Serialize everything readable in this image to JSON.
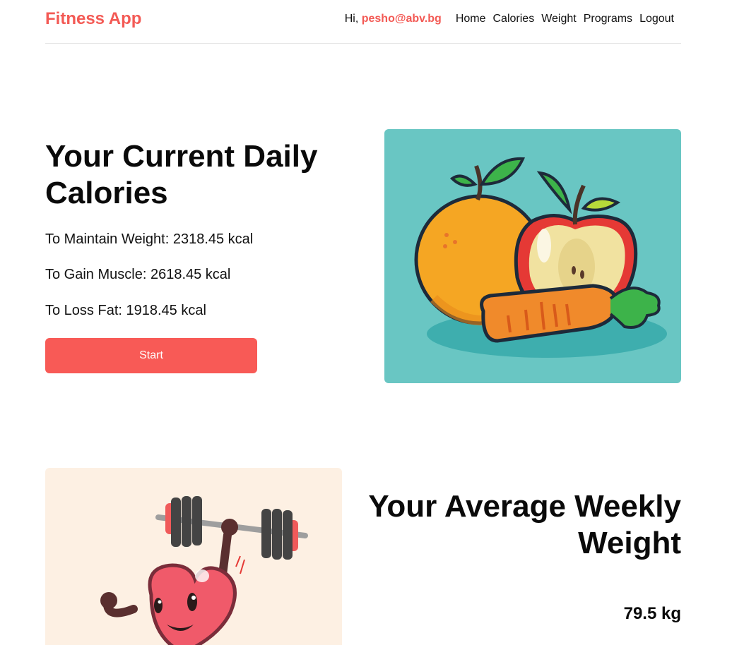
{
  "header": {
    "brand": "Fitness App",
    "greeting_prefix": "Hi, ",
    "user_email": "pesho@abv.bg",
    "nav": [
      {
        "label": "Home"
      },
      {
        "label": "Calories"
      },
      {
        "label": "Weight"
      },
      {
        "label": "Programs"
      },
      {
        "label": "Logout"
      }
    ]
  },
  "calories": {
    "title": "Your Current Daily Calories",
    "maintain": "To Maintain Weight: 2318.45 kcal",
    "gain": "To Gain Muscle: 2618.45 kcal",
    "loss": "To Loss Fat: 1918.45 kcal",
    "start_label": "Start"
  },
  "weight": {
    "title": "Your Average Weekly Weight",
    "value": "79.5 kg"
  },
  "colors": {
    "accent": "#f85a56",
    "brand": "#f35a55",
    "food_card_bg": "#69c6c3",
    "gym_card_bg": "#fdf0e3"
  },
  "icons": [
    "fruit-vegetable-illustration",
    "heart-lifting-dumbbell-illustration"
  ]
}
